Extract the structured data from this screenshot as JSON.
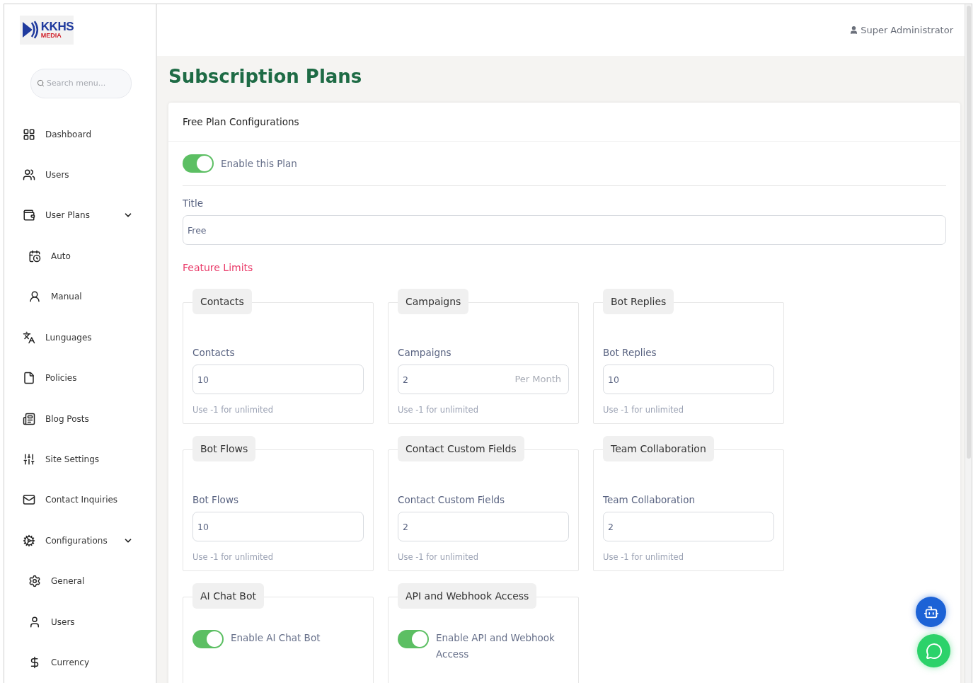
{
  "logo": {
    "line_1": "KKHS",
    "line_2": "MEDIA"
  },
  "sidebar": {
    "search": {
      "placeholder": "Search menu..."
    },
    "items": [
      {
        "label": "Dashboard"
      },
      {
        "label": "Users"
      },
      {
        "label": "User Plans",
        "expanded": true,
        "children": [
          {
            "label": "Auto"
          },
          {
            "label": "Manual"
          }
        ]
      },
      {
        "label": "Lunguages"
      },
      {
        "label": "Policies"
      },
      {
        "label": "Blog Posts"
      },
      {
        "label": "Site Settings"
      },
      {
        "label": "Contact Inquiries"
      },
      {
        "label": "Configurations",
        "expanded": true,
        "children": [
          {
            "label": "General"
          },
          {
            "label": "Users"
          },
          {
            "label": "Currency"
          }
        ]
      }
    ]
  },
  "header": {
    "user": "Super Administrator"
  },
  "page_title": "Subscription Plans",
  "card": {
    "title": "Free Plan Configurations",
    "enable": {
      "label": "Enable this Plan",
      "on": true
    },
    "title_field": {
      "label": "Title",
      "value": "Free"
    },
    "section_title": "Feature Limits",
    "features": [
      {
        "kind": "limit",
        "legend": "Contacts",
        "label": "Contacts",
        "value": "10",
        "hint": "Use -1 for unlimited"
      },
      {
        "kind": "limit",
        "legend": "Campaigns",
        "label": "Campaigns",
        "value": "2",
        "suffix": "Per Month",
        "hint": "Use -1 for unlimited"
      },
      {
        "kind": "limit",
        "legend": "Bot Replies",
        "label": "Bot Replies",
        "value": "10",
        "hint": "Use -1 for unlimited"
      },
      {
        "kind": "limit",
        "legend": "Bot Flows",
        "label": "Bot Flows",
        "value": "10",
        "hint": "Use -1 for unlimited"
      },
      {
        "kind": "limit",
        "legend": "Contact Custom Fields",
        "label": "Contact Custom Fields",
        "value": "2",
        "hint": "Use -1 for unlimited"
      },
      {
        "kind": "limit",
        "legend": "Team Collaboration",
        "label": "Team Collaboration",
        "value": "2",
        "hint": "Use -1 for unlimited"
      },
      {
        "kind": "toggle",
        "legend": "AI Chat Bot",
        "label": "Enable AI Chat Bot",
        "on": true
      },
      {
        "kind": "toggle",
        "legend": "API and Webhook Access",
        "label": "Enable API and Webhook Access",
        "on": true
      }
    ]
  }
}
